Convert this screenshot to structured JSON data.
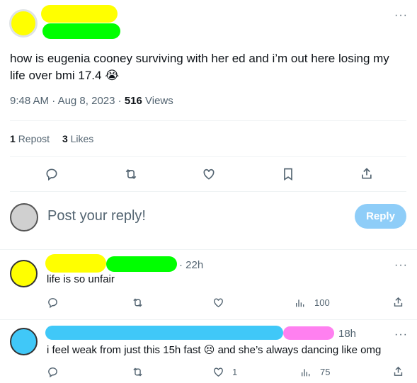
{
  "tweet": {
    "text": "how is eugenia cooney surviving with her ed and i’m out here losing my life over bmi 17.4",
    "emoji": "😭",
    "time": "9:48 AM",
    "sep1": "·",
    "date": "Aug 8, 2023",
    "sep2": "·",
    "views_count": "516",
    "views_label": "Views",
    "reposts_count": "1",
    "reposts_label": "Repost",
    "likes_count": "3",
    "likes_label": "Likes",
    "more": "···"
  },
  "reply_box": {
    "placeholder": "Post your reply!",
    "button": "Reply"
  },
  "replies": [
    {
      "time": "· 22h",
      "text": "life is so unfair",
      "likes": "",
      "views": "100",
      "more": "···"
    },
    {
      "time": "18h",
      "text_before": "i feel weak from just this 15h fast",
      "emoji": "😣",
      "text_after": "and she’s always dancing like omg",
      "likes": "1",
      "views": "75",
      "more": "···"
    }
  ],
  "colors": {
    "accent": "#1d9bf0",
    "scribble_yellow": "#ffff00",
    "scribble_green": "#00ff00",
    "scribble_cyan": "#40c8f8",
    "scribble_pink": "#ff80f0"
  }
}
